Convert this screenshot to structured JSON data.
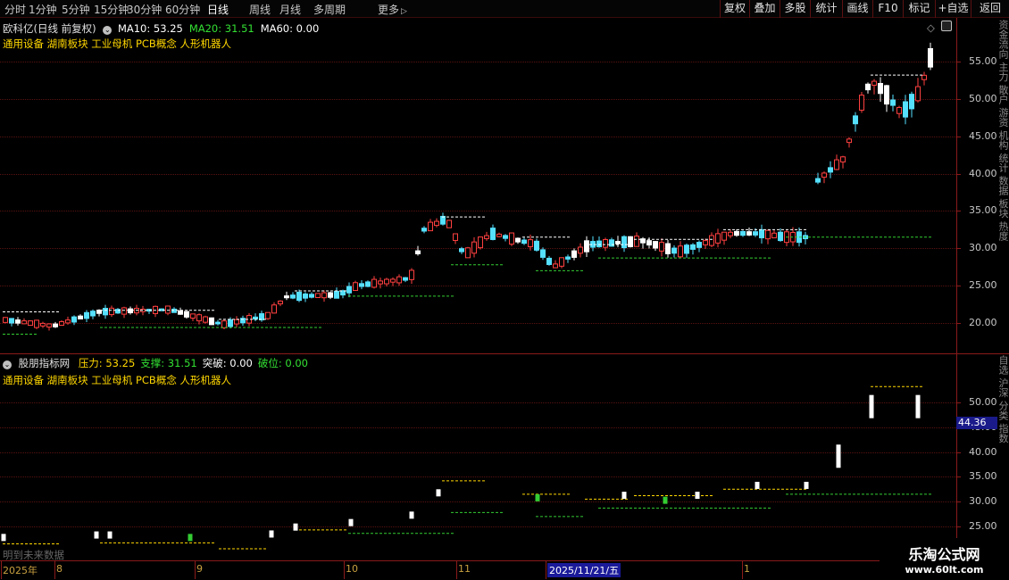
{
  "toolbar": {
    "periods": [
      "分时",
      "1分钟",
      "5分钟",
      "15分钟",
      "30分钟",
      "60分钟",
      "日线",
      "周线",
      "月线",
      "多周期",
      "更多"
    ],
    "active_period": "日线",
    "more_arrow": "▷",
    "buttons": [
      "复权",
      "叠加",
      "多股",
      "统计",
      "画线",
      "F10",
      "标记",
      "+自选",
      "返回"
    ]
  },
  "main_panel": {
    "stock_title": "欧科亿(日线 前复权)",
    "indicators": [
      {
        "label": "MA10: 53.25",
        "color": "#ffffff"
      },
      {
        "label": "MA20: 31.51",
        "color": "#33e033"
      },
      {
        "label": "MA60: 0.00",
        "color": "#ffffff"
      }
    ],
    "concepts": "通用设备 湖南板块 工业母机 PCB概念 人形机器人",
    "y_labels": [
      "55.00",
      "50.00",
      "45.00",
      "40.00",
      "35.00",
      "30.00",
      "25.00",
      "20.00"
    ],
    "right_strip": "资金流向 主力 散户 游资 机构 统计 数据 板块 热度"
  },
  "sub_panel": {
    "indicator_name": "股朋指标网",
    "values": [
      {
        "label": "压力: 53.25",
        "color": "#ffd700"
      },
      {
        "label": "支撑: 31.51",
        "color": "#33e033"
      },
      {
        "label": "突破: 0.00",
        "color": "#ffffff"
      },
      {
        "label": "破位: 0.00",
        "color": "#33e033"
      }
    ],
    "concepts": "通用设备 湖南板块 工业母机 PCB概念 人形机器人",
    "y_labels": [
      "50.00",
      "45.00",
      "40.00",
      "35.00",
      "30.00",
      "25.00"
    ],
    "current_price_tag": "44.36",
    "future_text": "明到未来数据",
    "right_strip": "自选 沪深 分类 指数"
  },
  "x_axis": {
    "labels": [
      "2025年",
      "8",
      "9",
      "10",
      "11",
      "2025/11/21/五",
      "1"
    ]
  },
  "watermark": {
    "line1": "乐淘公式网",
    "line2": "www.60lt.com"
  },
  "colors": {
    "up": "#ff4040",
    "down": "#55e0ff",
    "white_bar": "#ffffff",
    "resist": "#ffffff",
    "support": "#33cc33",
    "border": "#8a1a1a"
  }
}
